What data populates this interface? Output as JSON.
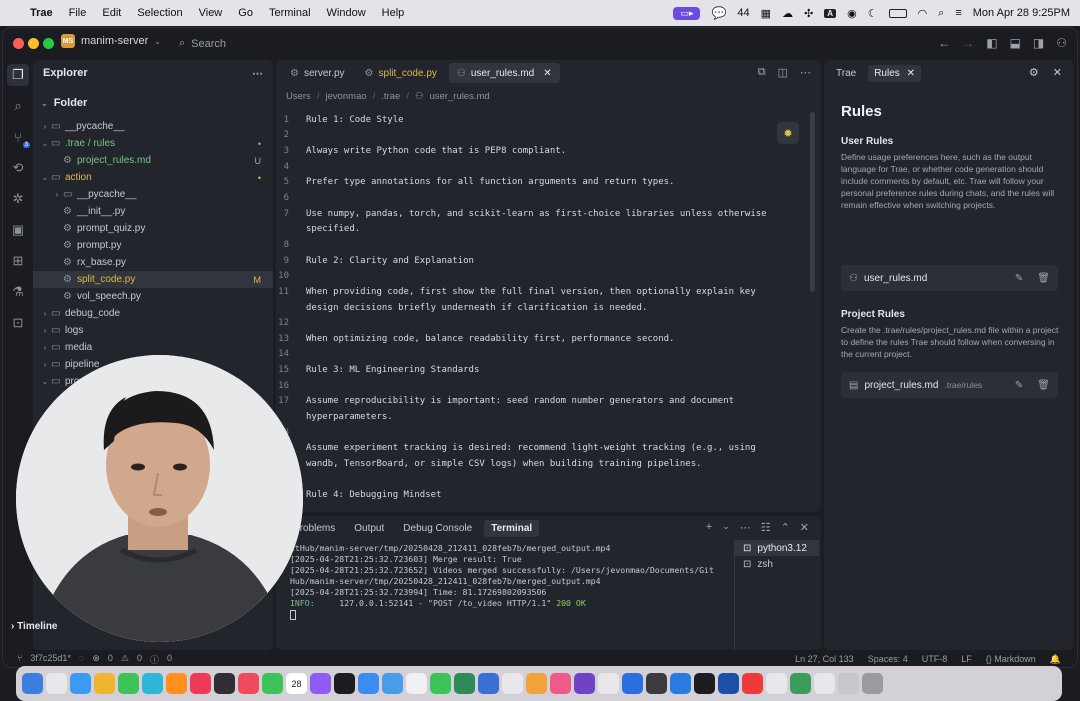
{
  "menubar": {
    "app": "Trae",
    "items": [
      "File",
      "Edit",
      "Selection",
      "View",
      "Go",
      "Terminal",
      "Window",
      "Help"
    ],
    "wechat_count": "44",
    "datetime": "Mon Apr 28  9:25PM"
  },
  "titlebar": {
    "project_badge": "MS",
    "project": "manim-server",
    "search_placeholder": "Search"
  },
  "activity": {
    "source_control_badge": "3"
  },
  "explorer": {
    "title": "Explorer",
    "folder_label": "Folder",
    "tree": [
      {
        "label": "__pycache__",
        "depth": 0,
        "kind": "folder",
        "open": false,
        "status": "",
        "color": "#c6c9d0"
      },
      {
        "label": ".trae / rules",
        "depth": 0,
        "kind": "folder",
        "open": true,
        "status": "•",
        "color": "#7cc38a"
      },
      {
        "label": "project_rules.md",
        "depth": 1,
        "kind": "file",
        "open": false,
        "status": "U",
        "color": "#7cc38a"
      },
      {
        "label": "action",
        "depth": 0,
        "kind": "folder",
        "open": true,
        "status": "•",
        "color": "#e0b84a"
      },
      {
        "label": "__pycache__",
        "depth": 1,
        "kind": "folder",
        "open": false,
        "status": "",
        "color": "#c6c9d0"
      },
      {
        "label": "__init__.py",
        "depth": 1,
        "kind": "file",
        "open": false,
        "status": "",
        "color": "#c6c9d0"
      },
      {
        "label": "prompt_quiz.py",
        "depth": 1,
        "kind": "file",
        "open": false,
        "status": "",
        "color": "#c6c9d0"
      },
      {
        "label": "prompt.py",
        "depth": 1,
        "kind": "file",
        "open": false,
        "status": "",
        "color": "#c6c9d0"
      },
      {
        "label": "rx_base.py",
        "depth": 1,
        "kind": "file",
        "open": false,
        "status": "",
        "color": "#c6c9d0"
      },
      {
        "label": "split_code.py",
        "depth": 1,
        "kind": "file",
        "open": false,
        "status": "M",
        "color": "#e0b84a",
        "selected": true
      },
      {
        "label": "vol_speech.py",
        "depth": 1,
        "kind": "file",
        "open": false,
        "status": "",
        "color": "#c6c9d0"
      },
      {
        "label": "debug_code",
        "depth": 0,
        "kind": "folder",
        "open": false,
        "status": "",
        "color": "#c6c9d0"
      },
      {
        "label": "logs",
        "depth": 0,
        "kind": "folder",
        "open": false,
        "status": "",
        "color": "#c6c9d0"
      },
      {
        "label": "media",
        "depth": 0,
        "kind": "folder",
        "open": false,
        "status": "",
        "color": "#c6c9d0"
      },
      {
        "label": "pipeline",
        "depth": 0,
        "kind": "folder",
        "open": false,
        "status": "",
        "color": "#c6c9d0"
      },
      {
        "label": "pro",
        "depth": 0,
        "kind": "folder",
        "open": true,
        "status": "",
        "color": "#c6c9d0"
      }
    ],
    "timeline": "Timeline"
  },
  "editor": {
    "tabs": [
      {
        "label": "server.py",
        "active": false,
        "modified": false
      },
      {
        "label": "split_code.py",
        "active": false,
        "modified": true
      },
      {
        "label": "user_rules.md",
        "active": true,
        "modified": false
      }
    ],
    "breadcrumb": [
      "Users",
      "jevonmao",
      ".trae",
      "user_rules.md"
    ],
    "lines": [
      {
        "n": "1",
        "t": "Rule 1: Code Style"
      },
      {
        "n": "2",
        "t": ""
      },
      {
        "n": "3",
        "t": "Always write Python code that is PEP8 compliant."
      },
      {
        "n": "4",
        "t": ""
      },
      {
        "n": "5",
        "t": "Prefer type annotations for all function arguments and return types."
      },
      {
        "n": "6",
        "t": ""
      },
      {
        "n": "7",
        "t": "Use numpy, pandas, torch, and scikit-learn as first-choice libraries unless otherwise"
      },
      {
        "n": "",
        "t": "specified."
      },
      {
        "n": "8",
        "t": ""
      },
      {
        "n": "9",
        "t": "Rule 2: Clarity and Explanation"
      },
      {
        "n": "10",
        "t": ""
      },
      {
        "n": "11",
        "t": "When providing code, first show the full final version, then optionally explain key"
      },
      {
        "n": "",
        "t": "design decisions briefly underneath if clarification is needed."
      },
      {
        "n": "12",
        "t": ""
      },
      {
        "n": "13",
        "t": "When optimizing code, balance readability first, performance second."
      },
      {
        "n": "14",
        "t": ""
      },
      {
        "n": "15",
        "t": "Rule 3: ML Engineering Standards"
      },
      {
        "n": "16",
        "t": ""
      },
      {
        "n": "17",
        "t": "Assume reproducibility is important: seed random number generators and document"
      },
      {
        "n": "",
        "t": "hyperparameters."
      },
      {
        "n": "18",
        "t": ""
      },
      {
        "n": "19",
        "t": "Assume experiment tracking is desired: recommend light-weight tracking (e.g., using"
      },
      {
        "n": "",
        "t": "wandb, TensorBoard, or simple CSV logs) when building training pipelines."
      },
      {
        "n": "20",
        "t": ""
      },
      {
        "n": "21",
        "t": "Rule 4: Debugging Mindset"
      }
    ]
  },
  "terminal": {
    "tabs": [
      "Problems",
      "Output",
      "Debug Console",
      "Terminal"
    ],
    "active_tab": "Terminal",
    "output": [
      {
        "text": "itHub/manim-server/tmp/20250428_212411_028feb7b/merged_output.mp4"
      },
      {
        "text": "[2025-04-28T21:25:32.723603] Merge result: True"
      },
      {
        "text": "[2025-04-28T21:25:32.723652] Videos merged successfully: /Users/jevonmao/Documents/Git"
      },
      {
        "text": "Hub/manim-server/tmp/20250428_212411_028feb7b/merged_output.mp4"
      },
      {
        "text": "[2025-04-28T21:25:32.723994] Time: 81.17269802093506"
      },
      {
        "info": "INFO:",
        "mid": "     127.0.0.1:52141 - \"POST /to_video HTTP/1.1\" ",
        "code": "200 OK"
      }
    ],
    "shells": [
      "python3.12",
      "zsh"
    ]
  },
  "rules_panel": {
    "tabs": [
      "Trae",
      "Rules"
    ],
    "title": "Rules",
    "user_rules": {
      "heading": "User Rules",
      "desc": "Define usage preferences here, such as the output language for Trae, or whether code generation should include comments by default, etc. Trae will follow your personal preference rules during chats, and the rules will remain effective when switching projects.",
      "file": "user_rules.md"
    },
    "project_rules": {
      "heading": "Project Rules",
      "desc": "Create the .trae/rules/project_rules.md file within a project to define the rules Trae should follow when conversing in the current project.",
      "file": "project_rules.md",
      "path": ".trae/rules"
    }
  },
  "statusbar": {
    "branch": "3f7c25d1*",
    "errors": "0",
    "warnings": "0",
    "info": "0",
    "position": "Ln 27, Col 133",
    "spaces": "Spaces: 4",
    "encoding": "UTF-8",
    "eol": "LF",
    "language": "Markdown"
  },
  "dock": {
    "calendar_day": "28",
    "colors": [
      "#3d7fe0",
      "#e8e8ea",
      "#3b9af2",
      "#f0b52e",
      "#3cc45a",
      "#2fb7d8",
      "#ff8f1f",
      "#ee3a56",
      "#2f2f33",
      "#f04a5f",
      "#3cc45a",
      "#ffd24a",
      "#8e5cf0",
      "#1d1d20",
      "#3c8cf0",
      "#4a9be8",
      "#f0f0f2",
      "#3cc45a",
      "#2e8b57",
      "#3a6fd8",
      "#e8e8ea",
      "#f2a23a",
      "#ee5a8a",
      "#6e44c4",
      "#e8e8ea",
      "#2a6fe0",
      "#3a3a3f",
      "#2a7be0",
      "#1d1d20",
      "#1d4fa8",
      "#ee3a3a",
      "#e8e8ea",
      "#3a9e5a",
      "#e8e8ea",
      "#c8c8cc",
      "#9a9aa0"
    ]
  }
}
